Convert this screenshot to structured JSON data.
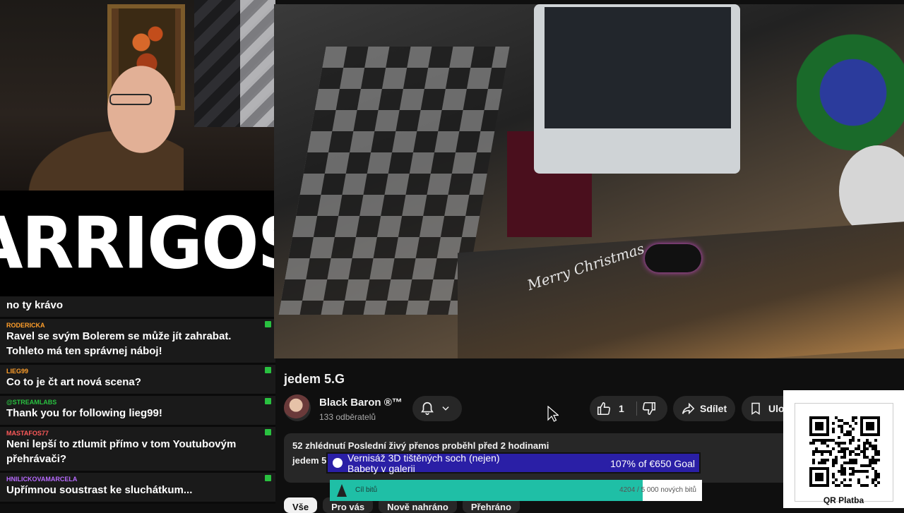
{
  "stream": {
    "logo_text": "ARRIGOS",
    "video_overlay_text": "Merry Christmas"
  },
  "chat": {
    "messages": [
      {
        "user": "",
        "text": "no ty krávo",
        "color": "#ffffff"
      },
      {
        "user": "RODERICKA",
        "text": "Ravel se svým Bolerem se může jít zahrabat. Tohleto má ten správnej náboj!",
        "color": "#ff9f2b"
      },
      {
        "user": "LIEG99",
        "text": "Co to je čt art nová scena?",
        "color": "#ff9f2b"
      },
      {
        "user": "@STREAMLABS",
        "text": "Thank you for following lieg99!",
        "color": "#29c140"
      },
      {
        "user": "MASTAFOS77",
        "text": "Neni lepší to ztlumit přímo v tom Youtubovým přehrávači?",
        "color": "#ff5a5a"
      },
      {
        "user": "HNILICKOVAMARCELA",
        "text": "Upřímnou soustrast ke sluchátkum...",
        "color": "#b86bff"
      }
    ]
  },
  "video": {
    "title": "jedem 5.G",
    "channel_name": "Black Baron ®™",
    "subscribers": "133 odběratelů",
    "likes": "1",
    "share_label": "Sdílet",
    "save_label": "Ulož",
    "meta": "52 zhlédnutí  Poslední živý přenos proběhl před 2 hodinami",
    "description_preview": "jedem 5"
  },
  "chips": [
    {
      "label": "Vše",
      "active": true
    },
    {
      "label": "Pro vás",
      "active": false
    },
    {
      "label": "Nově nahráno",
      "active": false
    },
    {
      "label": "Přehráno",
      "active": false
    }
  ],
  "goal": {
    "title_line1": "Vernisáž 3D tištěných soch (nejen)",
    "title_line2": "Babety v galerii",
    "value": "107% of €650 Goal"
  },
  "bits": {
    "label": "Cíl bitů",
    "value": "4204 / 5 000 nových bitů",
    "progress": 0.84
  },
  "qr": {
    "label": "QR Platba"
  },
  "colors": {
    "bg": "#0f0f0f",
    "pill": "#272727",
    "goal": "#2a1fa6",
    "bits_fill": "#1fbfa6"
  }
}
